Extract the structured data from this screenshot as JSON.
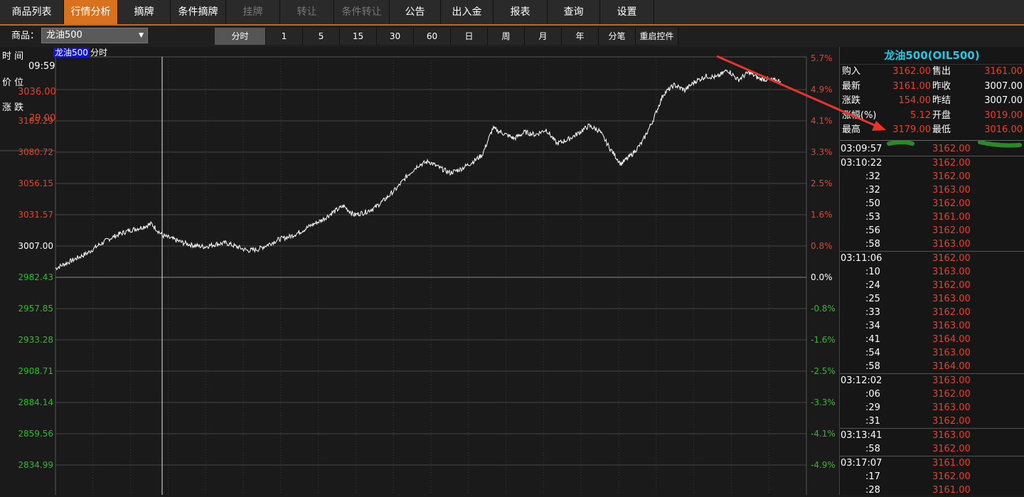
{
  "menu": [
    {
      "label": "商品列表",
      "w": 90,
      "state": "normal"
    },
    {
      "label": "行情分析",
      "w": 76,
      "state": "active"
    },
    {
      "label": "摘牌",
      "w": 74,
      "state": "normal"
    },
    {
      "label": "条件摘牌",
      "w": 78,
      "state": "normal"
    },
    {
      "label": "挂牌",
      "w": 76,
      "state": "disabled"
    },
    {
      "label": "转让",
      "w": 76,
      "state": "disabled"
    },
    {
      "label": "条件转让",
      "w": 78,
      "state": "disabled"
    },
    {
      "label": "公告",
      "w": 72,
      "state": "normal"
    },
    {
      "label": "出入金",
      "w": 74,
      "state": "normal"
    },
    {
      "label": "报表",
      "w": 76,
      "state": "normal"
    },
    {
      "label": "查询",
      "w": 74,
      "state": "normal"
    },
    {
      "label": "设置",
      "w": 76,
      "state": "normal"
    }
  ],
  "toolbar": {
    "goods_label": "商品：",
    "goods_value": "龙油500",
    "periods": [
      {
        "label": "分时",
        "active": true
      },
      {
        "label": "1"
      },
      {
        "label": "5"
      },
      {
        "label": "15"
      },
      {
        "label": "30"
      },
      {
        "label": "60"
      },
      {
        "label": "日"
      },
      {
        "label": "周"
      },
      {
        "label": "月"
      },
      {
        "label": "年"
      },
      {
        "label": "分笔"
      },
      {
        "label": "重启控件",
        "w": 60
      }
    ]
  },
  "info": {
    "time_label": "时 间",
    "time_value": "09:59",
    "price_label": "价 位",
    "price_value": "3036.00",
    "change_label": "涨 跌",
    "change_value": "29.00",
    "badge": "龙油500",
    "badge_label": "分时"
  },
  "colors": {
    "up": "#e8402a",
    "down": "#22c21e",
    "flat": "#ffffff",
    "accent": "#d8721f"
  },
  "chart_data": {
    "type": "line",
    "base_price": 3007.0,
    "y_ticks_left": [
      "3105.29",
      "3080.72",
      "3056.15",
      "3031.57",
      "3007.00",
      "2982.43",
      "2957.85",
      "2933.28",
      "2908.71",
      "2884.14",
      "2859.56",
      "2834.99"
    ],
    "y_ticks_right": [
      "5.7%",
      "4.9%",
      "4.1%",
      "3.3%",
      "2.5%",
      "1.6%",
      "0.8%",
      "0.0%",
      "-0.8%",
      "-1.6%",
      "-2.5%",
      "-3.3%",
      "-4.1%",
      "-4.9%"
    ],
    "price_range": [
      2834.99,
      3179.29
    ],
    "series": [
      {
        "name": "",
        "values": [
          3014,
          3018,
          3022,
          3026,
          3032,
          3037,
          3041,
          3044,
          3046,
          3049,
          3040,
          3037,
          3034,
          3032,
          3031,
          3033,
          3034,
          3031,
          3028,
          3029,
          3033,
          3037,
          3039,
          3043,
          3048,
          3052,
          3058,
          3063,
          3056,
          3058,
          3062,
          3069,
          3077,
          3087,
          3095,
          3098,
          3093,
          3089,
          3092,
          3097,
          3103,
          3124,
          3120,
          3116,
          3121,
          3119,
          3123,
          3112,
          3115,
          3120,
          3126,
          3122,
          3108,
          3096,
          3103,
          3113,
          3130,
          3151,
          3158,
          3154,
          3161,
          3165,
          3164,
          3170,
          3162,
          3168,
          3163,
          3162,
          3161
        ]
      }
    ],
    "vline_index": 10
  },
  "quote": {
    "title": "龙油500(OIL500)",
    "rows": [
      {
        "l1": "购入",
        "v1": "3162.00",
        "l2": "售出",
        "v2": "3161.00",
        "c1": "up",
        "c2": "up"
      },
      {
        "l1": "最新",
        "v1": "3161.00",
        "l2": "昨收",
        "v2": "3007.00",
        "c1": "up",
        "c2": "flat"
      },
      {
        "l1": "涨跌",
        "v1": "154.00",
        "l2": "昨结",
        "v2": "3007.00",
        "c1": "up",
        "c2": "flat"
      },
      {
        "l1": "涨幅(%)",
        "v1": "5.12",
        "l2": "开盘",
        "v2": "3019.00",
        "c1": "up",
        "c2": "up"
      },
      {
        "l1": "最高",
        "v1": "3179.00",
        "l2": "最低",
        "v2": "3016.00",
        "c1": "up",
        "c2": "up"
      }
    ]
  },
  "ticks": [
    {
      "t": "03:09:57",
      "p": "3162.00"
    },
    {
      "t": "03:10:22",
      "p": "3162.00"
    },
    {
      "t": ":32",
      "p": "3162.00"
    },
    {
      "t": ":32",
      "p": "3163.00"
    },
    {
      "t": ":50",
      "p": "3162.00"
    },
    {
      "t": ":53",
      "p": "3161.00"
    },
    {
      "t": ":56",
      "p": "3162.00"
    },
    {
      "t": ":58",
      "p": "3163.00"
    },
    {
      "t": "03:11:06",
      "p": "3162.00"
    },
    {
      "t": ":10",
      "p": "3163.00"
    },
    {
      "t": ":24",
      "p": "3162.00"
    },
    {
      "t": ":25",
      "p": "3163.00"
    },
    {
      "t": ":33",
      "p": "3162.00"
    },
    {
      "t": ":34",
      "p": "3163.00"
    },
    {
      "t": ":41",
      "p": "3164.00"
    },
    {
      "t": ":54",
      "p": "3163.00"
    },
    {
      "t": ":58",
      "p": "3164.00"
    },
    {
      "t": "03:12:02",
      "p": "3163.00"
    },
    {
      "t": ":06",
      "p": "3162.00"
    },
    {
      "t": ":29",
      "p": "3163.00"
    },
    {
      "t": ":31",
      "p": "3162.00"
    },
    {
      "t": "03:13:41",
      "p": "3163.00"
    },
    {
      "t": ":58",
      "p": "3162.00"
    },
    {
      "t": "03:17:07",
      "p": "3161.00"
    },
    {
      "t": ":17",
      "p": "3162.00"
    },
    {
      "t": ":28",
      "p": "3161.00"
    }
  ]
}
